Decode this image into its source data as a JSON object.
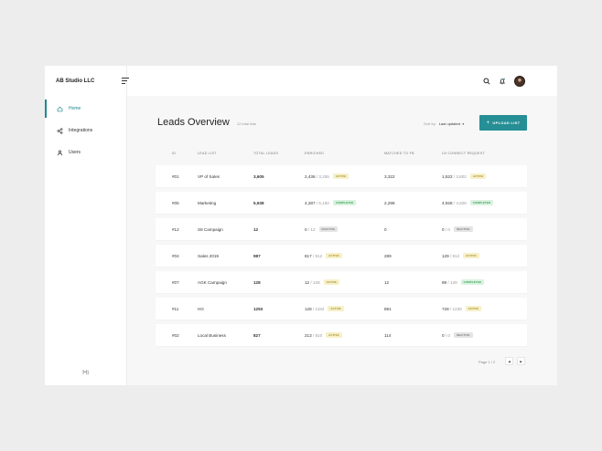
{
  "brand": "AB Studio LLC",
  "nav": [
    {
      "label": "Home",
      "icon": "home-icon",
      "active": true
    },
    {
      "label": "Integrations",
      "icon": "share-icon",
      "active": false
    },
    {
      "label": "Users",
      "icon": "user-icon",
      "active": false
    }
  ],
  "header": {
    "title": "Leads Overview",
    "total": "12 total lists",
    "sort_label": "Sort by:",
    "sort_value": "Last updated",
    "upload_label": "UPLOAD LIST"
  },
  "columns": [
    "ID",
    "LEAD LIST",
    "TOTAL LEADS",
    "ENRICHED",
    "MATCHED TO FB",
    "LN CONNECT REQUEST"
  ],
  "rows": [
    {
      "id": "#01",
      "list": "VP of Sales",
      "total": "3,605",
      "enriched": "2,436",
      "enriched_of": "/ 3,255",
      "enriched_status": "ACTIVE",
      "fb": "3,322",
      "ln": "1,522",
      "ln_of": "/ 3,802",
      "ln_status": "ACTIVE"
    },
    {
      "id": "#05",
      "list": "Marketing",
      "total": "5,938",
      "enriched": "4,287",
      "enriched_of": "/ 5,192",
      "enriched_status": "COMPLETED",
      "fb": "2,298",
      "ln": "4,928",
      "ln_of": "/ 4,928",
      "ln_status": "COMPLETED"
    },
    {
      "id": "#12",
      "list": "S8 Campaign",
      "total": "12",
      "enriched": "0",
      "enriched_of": "/ 12",
      "enriched_status": "INACTIVE",
      "fb": "0",
      "ln": "0",
      "ln_of": "/ 0",
      "ln_status": "INACTIVE"
    },
    {
      "id": "#04",
      "list": "Sales 2019",
      "total": "987",
      "enriched": "817",
      "enriched_of": "/ 912",
      "enriched_status": "ACTIVE",
      "fb": "289",
      "ln": "129",
      "ln_of": "/ 912",
      "ln_status": "ACTIVE"
    },
    {
      "id": "#07",
      "list": "AGK Campaign",
      "total": "128",
      "enriched": "12",
      "enriched_of": "/ 128",
      "enriched_status": "ACTIVE",
      "fb": "12",
      "ln": "89",
      "ln_of": "/ 128",
      "ln_status": "COMPLETED"
    },
    {
      "id": "#11",
      "list": "HG",
      "total": "1293",
      "enriched": "128",
      "enriched_of": "/ 1192",
      "enriched_status": "ACTIVE",
      "fb": "891",
      "ln": "728",
      "ln_of": "/ 1230",
      "ln_status": "ACTIVE"
    },
    {
      "id": "#02",
      "list": "Local Business",
      "total": "827",
      "enriched": "213",
      "enriched_of": "/ 810",
      "enriched_status": "ACTIVE",
      "fb": "114",
      "ln": "0",
      "ln_of": "/ 0",
      "ln_status": "INACTIVE"
    }
  ],
  "pagination": {
    "label": "Page 1 / 2",
    "prev": "◀",
    "next": "▶"
  }
}
